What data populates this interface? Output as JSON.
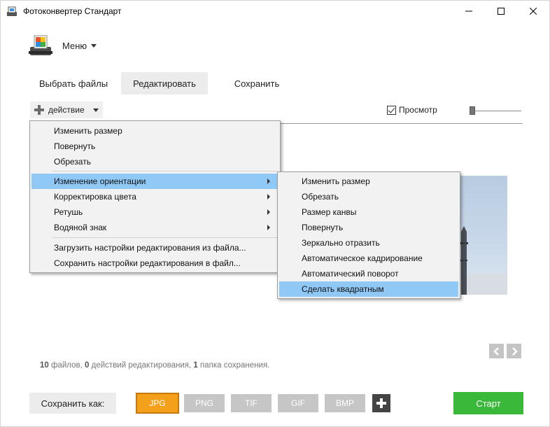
{
  "title": "Фотоконвертер Стандарт",
  "menu_label": "Меню",
  "tabs": [
    "Выбрать файлы",
    "Редактировать",
    "Сохранить"
  ],
  "action_label": "действие",
  "preview_label": "Просмотр",
  "preview_checked": true,
  "main_menu": {
    "items": [
      {
        "label": "Изменить размер"
      },
      {
        "label": "Повернуть"
      },
      {
        "label": "Обрезать"
      },
      {
        "label": "Изменение ориентации",
        "submenu": true,
        "highlighted": true
      },
      {
        "label": "Корректировка цвета",
        "submenu": true
      },
      {
        "label": "Ретушь",
        "submenu": true
      },
      {
        "label": "Водяной знак",
        "submenu": true
      },
      {
        "label": "Загрузить настройки редактирования из файла..."
      },
      {
        "label": "Сохранить настройки редактирования в файл..."
      }
    ]
  },
  "sub_menu": {
    "items": [
      {
        "label": "Изменить размер"
      },
      {
        "label": "Обрезать"
      },
      {
        "label": "Размер канвы"
      },
      {
        "label": "Повернуть"
      },
      {
        "label": "Зеркально отразить"
      },
      {
        "label": "Автоматическое кадрирование"
      },
      {
        "label": "Автоматический поворот"
      },
      {
        "label": "Сделать квадратным",
        "highlighted": true
      }
    ]
  },
  "status": {
    "files_count": "10",
    "files_text": "файлов,",
    "actions_count": "0",
    "actions_text": "действий редактирования,",
    "folders_count": "1",
    "folders_text": "папка сохранения."
  },
  "save_as_label": "Сохранить как:",
  "formats": [
    {
      "label": "JPG",
      "active": true
    },
    {
      "label": "PNG",
      "active": false
    },
    {
      "label": "TIF",
      "active": false
    },
    {
      "label": "GIF",
      "active": false
    },
    {
      "label": "BMP",
      "active": false
    }
  ],
  "start_label": "Старт",
  "colors": {
    "accent_orange": "#f5a01a",
    "start_green": "#3ab83a",
    "menu_highlight": "#90c8f6"
  }
}
